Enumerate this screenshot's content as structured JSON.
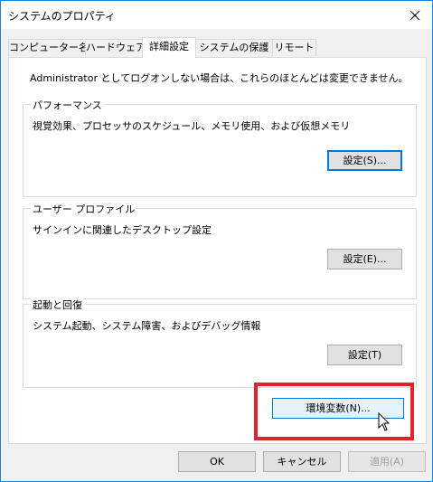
{
  "window": {
    "title": "システムのプロパティ",
    "close_glyph": "✕"
  },
  "tabs": [
    {
      "label": "コンピューター名"
    },
    {
      "label": "ハードウェア"
    },
    {
      "label": "詳細設定"
    },
    {
      "label": "システムの保護"
    },
    {
      "label": "リモート"
    }
  ],
  "advanced": {
    "admin_note": "Administrator としてログオンしない場合は、これらのほとんどは変更できません。",
    "performance": {
      "legend": "パフォーマンス",
      "description": "視覚効果、プロセッサのスケジュール、メモリ使用、および仮想メモリ",
      "button": "設定(S)..."
    },
    "user_profiles": {
      "legend": "ユーザー プロファイル",
      "description": "サインインに関連したデスクトップ設定",
      "button": "設定(E)..."
    },
    "startup_recovery": {
      "legend": "起動と回復",
      "description": "システム起動、システム障害、およびデバッグ情報",
      "button": "設定(T)"
    },
    "env_button": "環境変数(N)..."
  },
  "footer": {
    "ok": "OK",
    "cancel": "キャンセル",
    "apply": "適用(A)"
  },
  "colors": {
    "accent": "#0078d7",
    "highlight": "#e0232e",
    "border": "#1883d7"
  }
}
